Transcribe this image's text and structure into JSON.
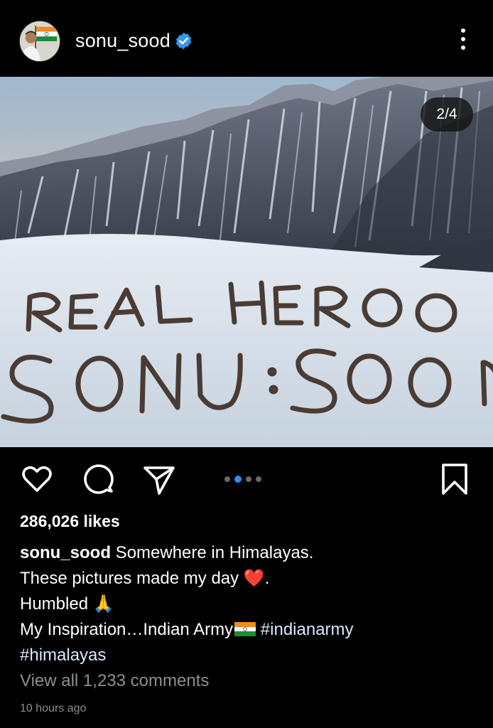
{
  "header": {
    "username": "sonu_sood",
    "verified_icon": "verified-badge-icon",
    "more_icon": "more-vertical-icon"
  },
  "post": {
    "counter": "2/4",
    "image_text_line1": "REAL HERO",
    "image_text_line2": "SONU SOOD"
  },
  "actions": {
    "like_icon": "heart-icon",
    "comment_icon": "comment-icon",
    "share_icon": "send-icon",
    "save_icon": "bookmark-icon",
    "carousel_total": 4,
    "carousel_active": 2
  },
  "likes": "286,026 likes",
  "caption": {
    "username": "sonu_sood",
    "line1": " Somewhere in Himalayas.",
    "line2": "These pictures made my day ",
    "line2_emoji": "❤️",
    "line2_end": ".",
    "line3": "Humbled ",
    "line3_emoji": "🙏",
    "line4": "My Inspiration…Indian Army",
    "hashtag1": "#indianarmy",
    "hashtag2": "#himalayas"
  },
  "comments_link": "View all 1,233 comments",
  "timestamp": "10 hours ago",
  "colors": {
    "background": "#000000",
    "accent_blue": "#2f8cf3",
    "muted": "#8e8e8e",
    "hashtag": "#dbe7ff"
  }
}
